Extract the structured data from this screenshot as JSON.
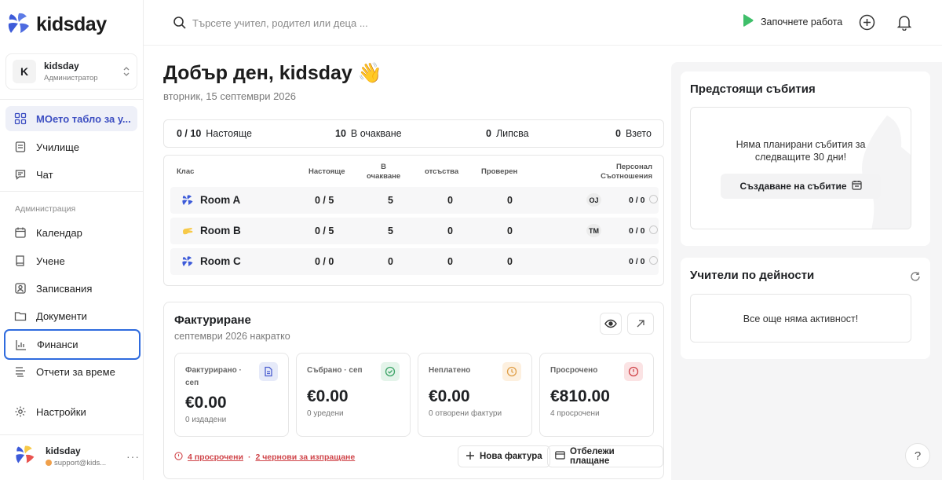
{
  "app": {
    "logo_text": "kidsday",
    "brand_color": "#3d5bd9",
    "accent_yellow": "#f7c948"
  },
  "org": {
    "initial": "K",
    "name": "kidsday",
    "role": "Администратор"
  },
  "nav": {
    "items": [
      {
        "label": "МОето табло за у...",
        "icon": "grid-icon",
        "active": true
      },
      {
        "label": "Училище",
        "icon": "school-icon"
      },
      {
        "label": "Чат",
        "icon": "chat-icon"
      }
    ],
    "section_label": "Администрация",
    "admin_items": [
      {
        "label": "Календар",
        "icon": "calendar-icon"
      },
      {
        "label": "Учене",
        "icon": "book-icon"
      },
      {
        "label": "Записвания",
        "icon": "enrollment-icon"
      },
      {
        "label": "Документи",
        "icon": "folder-icon"
      },
      {
        "label": "Финанси",
        "icon": "chart-icon",
        "focused": true
      },
      {
        "label": "Отчети за време",
        "icon": "timesheet-icon"
      }
    ],
    "settings_label": "Настройки"
  },
  "user": {
    "name": "kidsday",
    "email": "support@kids..."
  },
  "topbar": {
    "search_placeholder": "Търсете учител, родител или деца ...",
    "start_label": "Започнете работа"
  },
  "greeting": {
    "title": "Добър ден, kidsday 👋",
    "date": "вторник, 15 септември 2026"
  },
  "stats": [
    {
      "value": "0 / 10",
      "label": "Настояще"
    },
    {
      "value": "10",
      "label": "В очакване"
    },
    {
      "value": "0",
      "label": "Липсва"
    },
    {
      "value": "0",
      "label": "Взето"
    }
  ],
  "table": {
    "headers": {
      "class": "Клас",
      "present": "Настояще",
      "pending_1": "В",
      "pending_2": "очакване",
      "absent": "отсъства",
      "checked": "Проверен",
      "staff_1": "Персонал",
      "staff_2": "Съотношения"
    },
    "rows": [
      {
        "name": "Room A",
        "present": "0 / 5",
        "pending": "5",
        "absent": "0",
        "checked": "0",
        "staff": "OJ",
        "ratio": "0 / 0",
        "icon_color": "#3d5bd9"
      },
      {
        "name": "Room B",
        "present": "0 / 5",
        "pending": "5",
        "absent": "0",
        "checked": "0",
        "staff": "TM",
        "ratio": "0 / 0",
        "icon_color": "#f7c948"
      },
      {
        "name": "Room C",
        "present": "0 / 0",
        "pending": "0",
        "absent": "0",
        "checked": "0",
        "staff": "",
        "ratio": "0 / 0",
        "icon_color": "#3d5bd9"
      }
    ]
  },
  "billing": {
    "title": "Фактуриране",
    "subtitle": "септември 2026 накратко",
    "metrics": [
      {
        "label": "Фактурирано · сеп",
        "value": "€0.00",
        "sub": "0 издадени",
        "icon": "document-icon",
        "tint": "#e6eaf9",
        "color": "#4c5fd0"
      },
      {
        "label": "Събрано · сеп",
        "value": "€0.00",
        "sub": "0 уредени",
        "icon": "check-circle-icon",
        "tint": "#e4f4ea",
        "color": "#3ba466"
      },
      {
        "label": "Неплатено",
        "value": "€0.00",
        "sub": "0 отворени фактури",
        "icon": "clock-icon",
        "tint": "#fdf0df",
        "color": "#e0a04a"
      },
      {
        "label": "Просрочено",
        "value": "€810.00",
        "sub": "4 просрочени",
        "icon": "alert-circle-icon",
        "tint": "#fbe3e4",
        "color": "#d0454a"
      }
    ],
    "alert_overdue": "4 просрочени",
    "alert_sep": "·",
    "alert_drafts": "2 чернови за изпращане",
    "new_invoice_label": "Нова фактура",
    "record_payment_label": "Отбележи плащане"
  },
  "events": {
    "title": "Предстоящи събития",
    "empty_line1": "Няма планирани събития за",
    "empty_line2": "следващите 30 дни!",
    "create_label": "Създаване на събитие"
  },
  "teachers": {
    "title": "Учители по дейности",
    "empty": "Все още няма активност!"
  },
  "help_label": "?"
}
